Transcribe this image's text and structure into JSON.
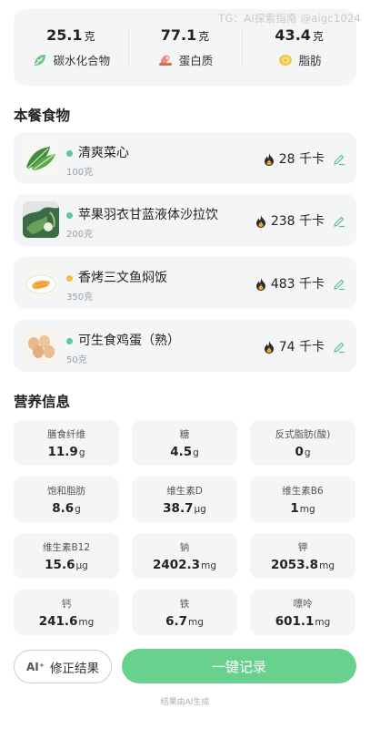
{
  "watermark": "TG：AI探索指南 @aigc1024",
  "macros": [
    {
      "value": "25.1",
      "unit": "克",
      "label": "碳水化合物",
      "icon": "leaf-icon",
      "color": "#5bbf7a"
    },
    {
      "value": "77.1",
      "unit": "克",
      "label": "蛋白质",
      "icon": "meat-icon",
      "color": "#e0665a"
    },
    {
      "value": "43.4",
      "unit": "克",
      "label": "脂肪",
      "icon": "fat-drop-icon",
      "color": "#e8b931"
    }
  ],
  "meal": {
    "title": "本餐食物",
    "kcal_unit": "千卡",
    "items": [
      {
        "name": "清爽菜心",
        "amount": "100克",
        "kcal": "28",
        "dot_color": "#5cc8a0",
        "image": "greens-food-image"
      },
      {
        "name": "苹果羽衣甘蓝液体沙拉饮",
        "amount": "200克",
        "kcal": "238",
        "dot_color": "#5cc8a0",
        "image": "kale-salad-food-image"
      },
      {
        "name": "香烤三文鱼焖饭",
        "amount": "350克",
        "kcal": "483",
        "dot_color": "#f2c13d",
        "image": "salmon-rice-food-image"
      },
      {
        "name": "可生食鸡蛋（熟）",
        "amount": "50克",
        "kcal": "74",
        "dot_color": "#5cc8a0",
        "image": "eggs-food-image"
      }
    ]
  },
  "nutrition": {
    "title": "营养信息",
    "items": [
      {
        "label": "膳食纤维",
        "value": "11.9",
        "unit": "g"
      },
      {
        "label": "糖",
        "value": "4.5",
        "unit": "g"
      },
      {
        "label": "反式脂肪(酸)",
        "value": "0",
        "unit": "g"
      },
      {
        "label": "饱和脂肪",
        "value": "8.6",
        "unit": "g"
      },
      {
        "label": "维生素D",
        "value": "38.7",
        "unit": "μg"
      },
      {
        "label": "维生素B6",
        "value": "1",
        "unit": "mg"
      },
      {
        "label": "维生素B12",
        "value": "15.6",
        "unit": "μg"
      },
      {
        "label": "钠",
        "value": "2402.3",
        "unit": "mg"
      },
      {
        "label": "钾",
        "value": "2053.8",
        "unit": "mg"
      },
      {
        "label": "钙",
        "value": "241.6",
        "unit": "mg"
      },
      {
        "label": "铁",
        "value": "6.7",
        "unit": "mg"
      },
      {
        "label": "嘌呤",
        "value": "601.1",
        "unit": "mg"
      }
    ]
  },
  "actions": {
    "correct_icon": "AI⁺",
    "correct_label": "修正结果",
    "record_label": "一键记录"
  },
  "footer_note": "结果由AI生成",
  "colors": {
    "accent": "#69d18e",
    "card_bg": "#f4f5f7"
  }
}
